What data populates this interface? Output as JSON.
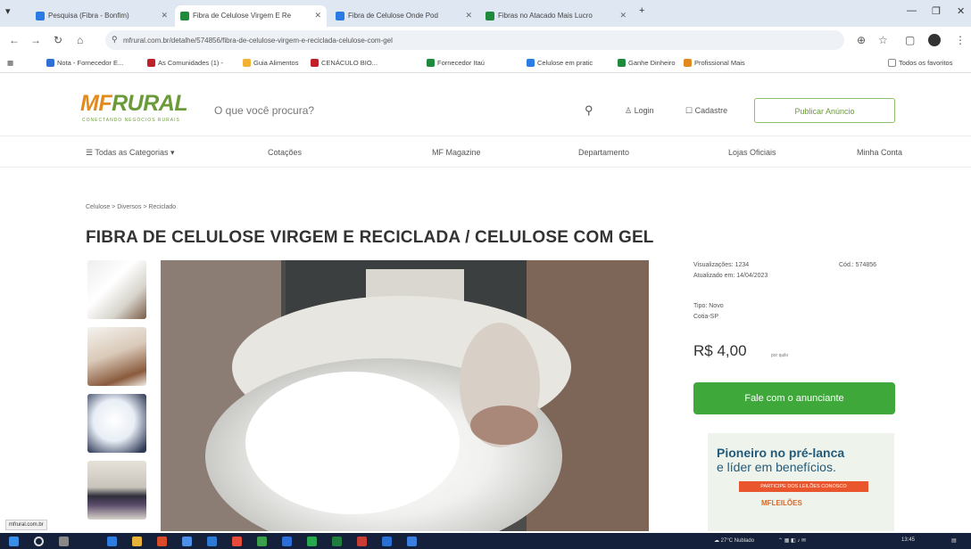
{
  "browser": {
    "tabs": [
      {
        "label": "Pesquisa (Fibra - Bonfim)",
        "color": "#2a7be4"
      },
      {
        "label": "Fibra de Celulose Virgem E Re",
        "color": "#1f8a3c"
      },
      {
        "label": "Fibra de Celulose Onde Pod",
        "color": "#2a7be4"
      },
      {
        "label": "Fibras no Atacado Mais Lucro",
        "color": "#1f8a3c"
      }
    ],
    "new_tab": "+",
    "url": "mfrural.com.br/detalhe/574856/fibra-de-celulose-virgem-e-reciclada-celulose-com-gel",
    "bookmarks": [
      {
        "label": "Nota - Fornecedor E...",
        "color": "#2f6fd6"
      },
      {
        "label": "As Comunidades (1) -",
        "color": "#c0202a"
      },
      {
        "label": "Guia Alimentos",
        "color": "#f2b233"
      },
      {
        "label": "CENÁCULO BIO...",
        "color": "#c0202a"
      },
      {
        "label": "Fornecedor Itaú",
        "color": "#1f8a3c"
      },
      {
        "label": "Celulose em pratic",
        "color": "#2a7be4"
      },
      {
        "label": "Ganhe Dinheiro",
        "color": "#1f8a3c"
      },
      {
        "label": "Profissional Mais",
        "color": "#e38a1e"
      }
    ],
    "bookmarks_right": "Todos os favoritos"
  },
  "site": {
    "logo_mf": "MF",
    "logo_rest": "RURAL",
    "logo_tagline": "CONECTANDO NEGÓCIOS RURAIS",
    "search_placeholder": "O que você procura?",
    "login": "Login",
    "cart": "Cadastre",
    "publish": "Publicar Anúncio",
    "categories": [
      "Todas as Categorias",
      "Cotações",
      "MF Magazine",
      "Departamento",
      "Lojas Oficiais",
      "Minha Conta"
    ]
  },
  "product": {
    "breadcrumb": "Celulose > Diversos > Reciclado",
    "title": "FIBRA DE CELULOSE VIRGEM E RECICLADA / CELULOSE COM GEL",
    "published": "Atualizado em: 14/04/2023",
    "views": "Visualizações: 1234",
    "code": "Cód.: 574856",
    "seller_label": "Tipo: Novo",
    "location": "Cotia-SP",
    "price": "R$ 4,00",
    "price_unit": "por quilo",
    "contact_button": "Fale com o anunciante"
  },
  "ad": {
    "line1": "Pioneiro no pré-lanca",
    "line2": "e líder em benefícios.",
    "strip": "PARTICIPE DOS LEILÕES CONOSCO",
    "brand": "MFLEILÕES"
  },
  "status_url": "mfrural.com.br"
}
